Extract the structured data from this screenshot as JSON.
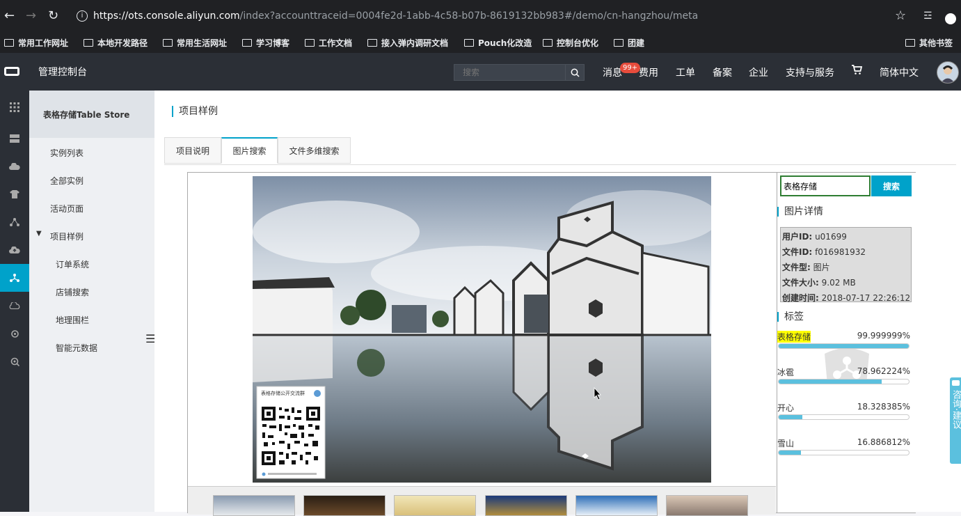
{
  "browser": {
    "url_host": "https://ots.console.aliyun.com",
    "url_rest": "/index?accounttraceid=0004fe2d-1abb-4c58-b07b-8619132bb983#/demo/cn-hangzhou/meta",
    "bookmarks": [
      "常用工作网址",
      "本地开发路径",
      "常用生活网址",
      "学习博客",
      "工作文档",
      "接入弹内调研文档",
      "Pouch化改造",
      "控制台优化",
      "团建",
      "其他书签"
    ]
  },
  "header": {
    "console_title": "管理控制台",
    "search_placeholder": "搜索",
    "nav": {
      "messages": "消息",
      "messages_badge": "99+",
      "billing": "费用",
      "ticket": "工单",
      "icp": "备案",
      "enterprise": "企业",
      "support": "支持与服务",
      "language": "简体中文"
    }
  },
  "sidebar": {
    "product_title": "表格存储Table Store",
    "items": {
      "instances": "实例列表",
      "all_instances": "全部实例",
      "activity": "活动页面",
      "samples": "项目样例",
      "orders": "订单系统",
      "store_search": "店铺搜索",
      "geofence": "地理围栏",
      "smart_meta": "智能元数据"
    }
  },
  "main": {
    "page_title": "项目样例",
    "tabs": {
      "intro": "项目说明",
      "image_search": "图片搜索",
      "file_search": "文件多维搜索"
    }
  },
  "qr_card": {
    "title": "表格存储公开交流群"
  },
  "detail": {
    "search_value": "表格存储",
    "search_button": "搜索",
    "info_title": "图片详情",
    "info": {
      "user_id_label": "用户ID:",
      "user_id": "u01699",
      "file_id_label": "文件ID:",
      "file_id": "f016981932",
      "file_type_label": "文件型:",
      "file_type": "图片",
      "file_size_label": "文件大小:",
      "file_size": "9.02 MB",
      "created_label": "创建时间:",
      "created": "2018-07-17 22:26:12"
    },
    "tags_title": "标签",
    "tags": [
      {
        "label": "表格存储",
        "pct": "99.999999%",
        "value": 0.99999999
      },
      {
        "label": "冰雹",
        "pct": "78.962224%",
        "value": 0.78962224
      },
      {
        "label": "开心",
        "pct": "18.328385%",
        "value": 0.18328385
      },
      {
        "label": "雪山",
        "pct": "16.886812%",
        "value": 0.16886812
      }
    ]
  },
  "feedback": {
    "label": "咨询·建议"
  },
  "colors": {
    "accent": "#00a2ca",
    "topbar": "#2b2f36",
    "badge": "#e74c3c",
    "tag_bar": "#5bc0de",
    "tag_highlight": "#ffff00"
  }
}
